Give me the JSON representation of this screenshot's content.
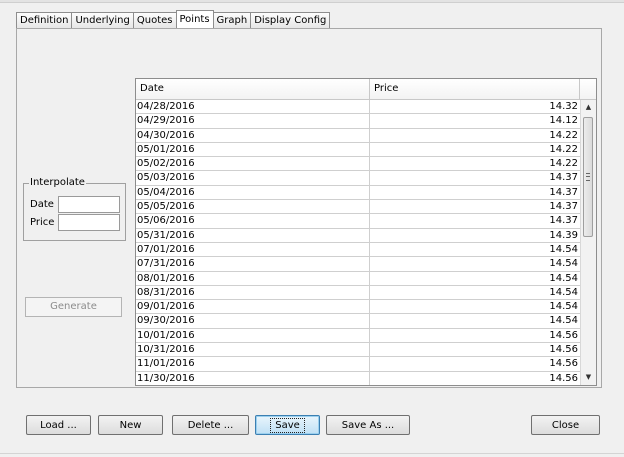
{
  "tabs": [
    {
      "label": "Definition"
    },
    {
      "label": "Underlying"
    },
    {
      "label": "Quotes"
    },
    {
      "label": "Points",
      "active": true
    },
    {
      "label": "Graph"
    },
    {
      "label": "Display Config"
    }
  ],
  "interpolate": {
    "title": "Interpolate",
    "date_label": "Date",
    "price_label": "Price",
    "date_value": "",
    "price_value": ""
  },
  "generate_label": "Generate",
  "table": {
    "columns": [
      "Date",
      "Price"
    ],
    "rows": [
      {
        "date": "04/28/2016",
        "price": "14.32"
      },
      {
        "date": "04/29/2016",
        "price": "14.12"
      },
      {
        "date": "04/30/2016",
        "price": "14.22"
      },
      {
        "date": "05/01/2016",
        "price": "14.22"
      },
      {
        "date": "05/02/2016",
        "price": "14.22"
      },
      {
        "date": "05/03/2016",
        "price": "14.37"
      },
      {
        "date": "05/04/2016",
        "price": "14.37"
      },
      {
        "date": "05/05/2016",
        "price": "14.37"
      },
      {
        "date": "05/06/2016",
        "price": "14.37"
      },
      {
        "date": "05/31/2016",
        "price": "14.39"
      },
      {
        "date": "07/01/2016",
        "price": "14.54"
      },
      {
        "date": "07/31/2016",
        "price": "14.54"
      },
      {
        "date": "08/01/2016",
        "price": "14.54"
      },
      {
        "date": "08/31/2016",
        "price": "14.54"
      },
      {
        "date": "09/01/2016",
        "price": "14.54"
      },
      {
        "date": "09/30/2016",
        "price": "14.54"
      },
      {
        "date": "10/01/2016",
        "price": "14.56"
      },
      {
        "date": "10/31/2016",
        "price": "14.56"
      },
      {
        "date": "11/01/2016",
        "price": "14.56"
      },
      {
        "date": "11/30/2016",
        "price": "14.56"
      }
    ]
  },
  "buttons": {
    "load": "Load ...",
    "new": "New",
    "delete": "Delete ...",
    "save": "Save",
    "save_as": "Save As ...",
    "close": "Close"
  }
}
